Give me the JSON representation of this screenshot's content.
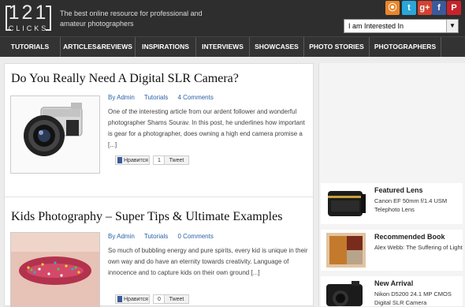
{
  "header": {
    "logo_number": "121",
    "logo_sub": "CLICKS",
    "tagline": "The best online resource for professional and amateur photographers",
    "social": [
      {
        "name": "rss",
        "glyph": "⦿"
      },
      {
        "name": "twitter",
        "glyph": "t"
      },
      {
        "name": "google-plus",
        "glyph": "g+"
      },
      {
        "name": "facebook",
        "glyph": "f"
      },
      {
        "name": "pinterest",
        "glyph": "P"
      }
    ],
    "dropdown_value": "I am Interested In",
    "dropdown_arrow": "▼"
  },
  "nav": {
    "items": [
      "TUTORIALS",
      "ARTICLES&REVIEWS",
      "INSPIRATIONS",
      "INTERVIEWS",
      "SHOWCASES",
      "PHOTO STORIES",
      "PHOTOGRAPHERS"
    ]
  },
  "posts": [
    {
      "title": "Do You Really Need A Digital SLR Camera?",
      "author": "By Admin",
      "category": "Tutorials",
      "comments": "4 Comments",
      "excerpt": "One of the interesting article from our ardent follower and wonderful photographer Shams Sourav. In this post, he underlines how important is gear for a photographer, does owning a high end camera promise a [...]",
      "like_label": "Нравится",
      "like_count": "1",
      "tweet_label": "Tweet"
    },
    {
      "title": "Kids Photography – Super Tips & Ultimate Examples",
      "author": "By Admin",
      "category": "Tutorials",
      "comments": "0 Comments",
      "excerpt": "So much of bubbling energy and pure spirits, every kid is unique in their own way and do have an eternity towards creativity. Language of innocence and to capture kids on their own ground [...]",
      "like_label": "Нравится",
      "like_count": "0",
      "tweet_label": "Tweet"
    }
  ],
  "sidebar": {
    "widgets": [
      {
        "title": "Featured Lens",
        "text": "Canon EF 50mm f/1.4 USM Telephoto Lens"
      },
      {
        "title": "Recommended Book",
        "text": "Alex Webb: The Suffering of Light"
      },
      {
        "title": "New Arrival",
        "text": "Nikon D5200 24.1 MP CMOS Digital SLR Camera"
      }
    ]
  },
  "colors": {
    "header_bg": "#2e2e2e",
    "nav_bg": "#333333",
    "link_blue": "#2a5fa8",
    "page_bg": "#ececec"
  }
}
